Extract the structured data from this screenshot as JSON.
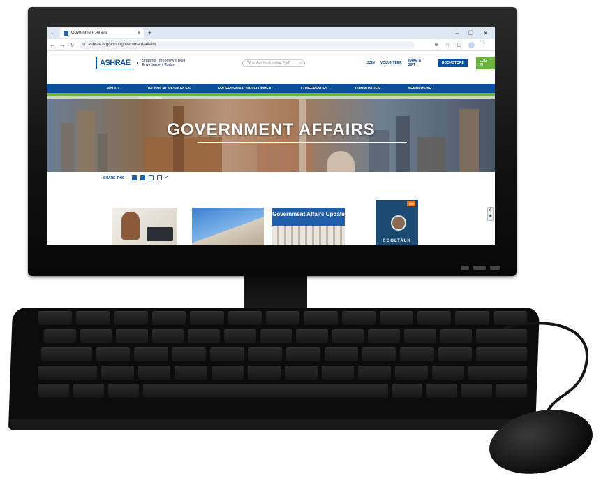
{
  "browser": {
    "tab_title": "Government Affairs",
    "tab_close": "×",
    "new_tab": "+",
    "url": "ashrae.org/about/government-affairs",
    "win_min": "–",
    "win_max": "❐",
    "win_close": "✕"
  },
  "site": {
    "logo": "ASHRAE",
    "tagline": "Shaping Tomorrow's Built Environment Today",
    "search_placeholder": "What Are You Looking For?",
    "top_links": [
      "JOIN",
      "VOLUNTEER",
      "MAKE A GIFT"
    ],
    "bookstore": "BOOKSTORE",
    "login": "LOG IN",
    "nav": [
      "ABOUT",
      "TECHNICAL RESOURCES",
      "PROFESSIONAL DEVELOPMENT",
      "CONFERENCES",
      "COMMUNITIES",
      "MEMBERSHIP"
    ],
    "breadcrumb": "Government Affairs",
    "hero_title": "GOVERNMENT AFFAIRS",
    "share_label": "SHARE THIS",
    "cards": {
      "card3_title": "Government Affairs Update",
      "card4_badge": "TTE",
      "card4_title": "COOLTALK"
    }
  },
  "colors": {
    "brand_blue": "#0b4f9c",
    "brand_green": "#6cb33f"
  }
}
